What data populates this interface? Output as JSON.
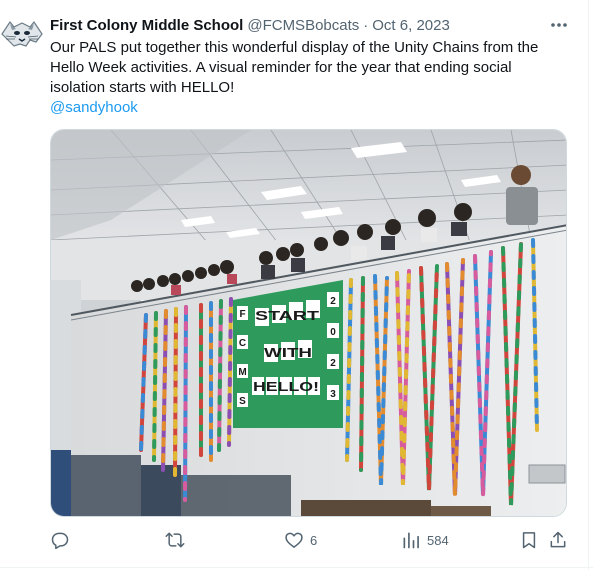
{
  "tweet": {
    "author_name": "First Colony Middle School",
    "handle": "@FCMSBobcats",
    "separator": "·",
    "date": "Oct 6, 2023",
    "text_lines": [
      "Our PALS put together this wonderful display of the Unity Chains from the",
      "Hello Week activities. A visual reminder for the year that ending social",
      "isolation starts with HELLO!"
    ],
    "mention": "@sandyhook"
  },
  "banner": {
    "left_column": [
      "F",
      "C",
      "M",
      "S"
    ],
    "right_column": [
      "2",
      "0",
      "2",
      "3"
    ],
    "lines": [
      "START",
      "WITH",
      "HELLO!"
    ]
  },
  "actions": {
    "reply_count": "",
    "retweet_count": "",
    "like_count": "6",
    "views_count": "584"
  },
  "icons": {
    "avatar": "bobcat-logo-icon",
    "more": "more-icon",
    "reply": "reply-icon",
    "retweet": "retweet-icon",
    "like": "heart-icon",
    "views": "views-icon",
    "bookmark": "bookmark-icon",
    "share": "share-icon"
  },
  "colors": {
    "text": "#0f1419",
    "secondary": "#536471",
    "link": "#1d9bf0",
    "banner_green": "#2e9a5c"
  }
}
